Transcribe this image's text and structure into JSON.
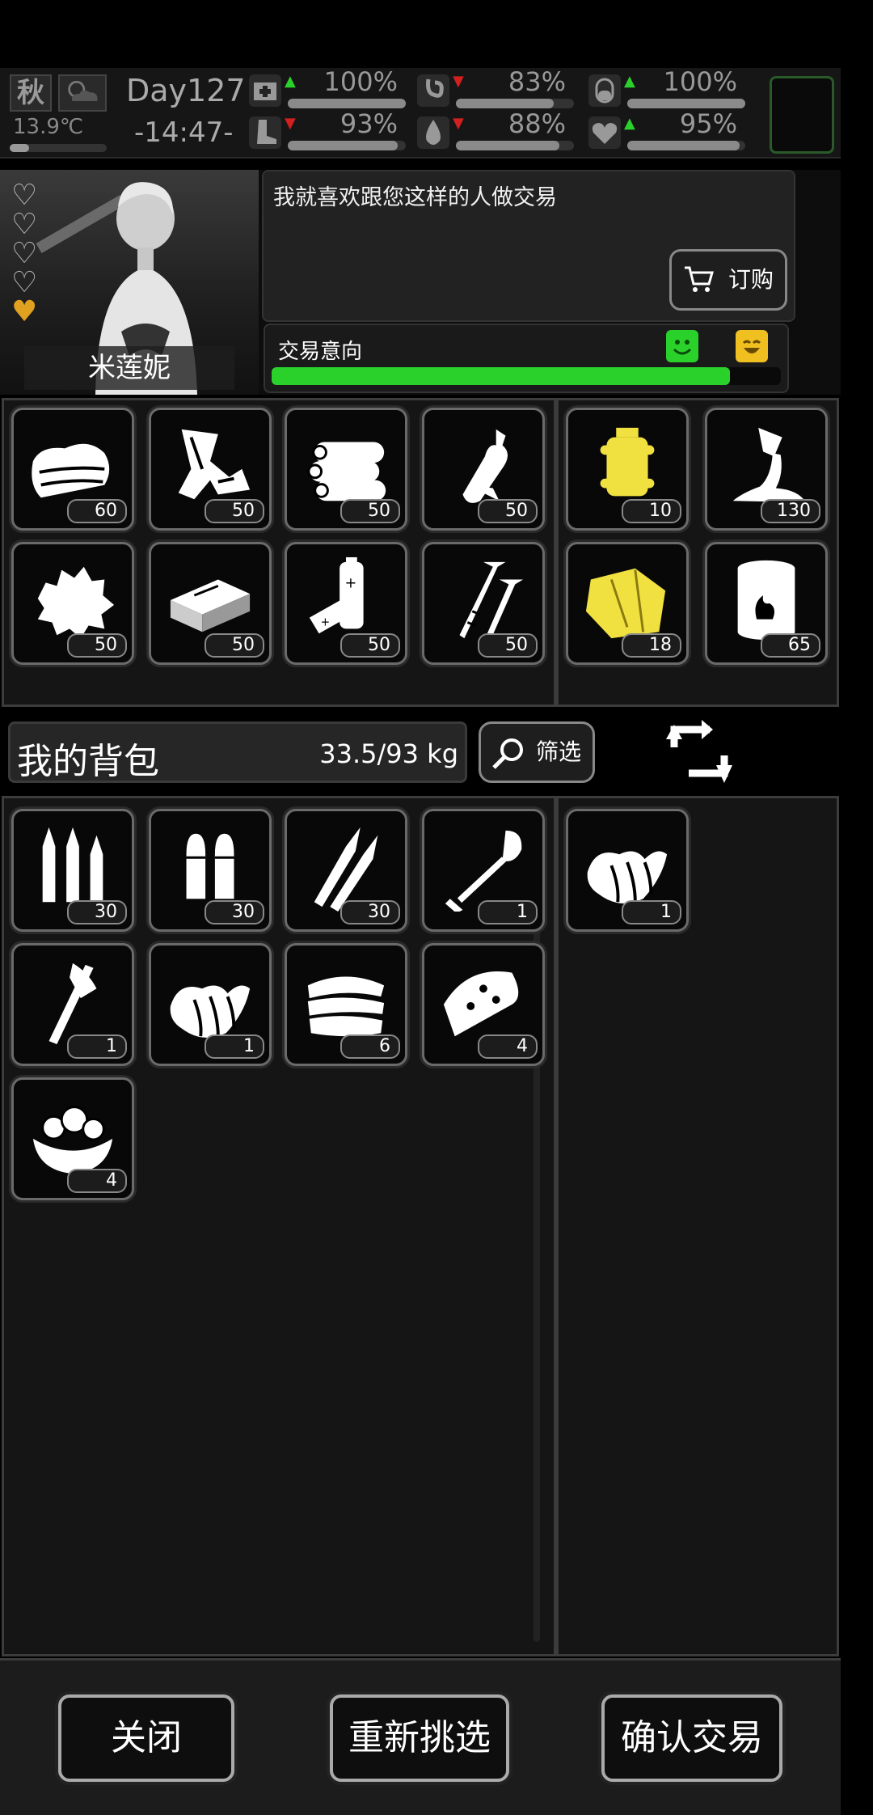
{
  "status": {
    "season": "秋",
    "temperature": "13.9℃",
    "day": "Day127",
    "time": "-14:47-",
    "stats": [
      {
        "name": "health",
        "icon": "medkit-icon",
        "value": "100%",
        "level": 1.0,
        "trend": "up"
      },
      {
        "name": "hunger",
        "icon": "stomach-icon",
        "value": "83%",
        "level": 0.83,
        "trend": "down"
      },
      {
        "name": "medicine",
        "icon": "pill-icon",
        "value": "100%",
        "level": 1.0,
        "trend": "up"
      },
      {
        "name": "stamina",
        "icon": "boot-icon",
        "value": "93%",
        "level": 0.93,
        "trend": "down"
      },
      {
        "name": "thirst",
        "icon": "water-drop-icon",
        "value": "88%",
        "level": 0.88,
        "trend": "down"
      },
      {
        "name": "mood",
        "icon": "heart-icon",
        "value": "95%",
        "level": 0.95,
        "trend": "up"
      }
    ]
  },
  "trader": {
    "name": "米莲妮",
    "message": "我就喜欢跟您这样的人做交易",
    "order_label": "订购",
    "intent_label": "交易意向",
    "intent_level": 0.9,
    "hearts": 5,
    "gold_hearts": 1
  },
  "trader_items": [
    {
      "icon": "cloth-icon",
      "count": "60"
    },
    {
      "icon": "scrap-metal-icon",
      "count": "50"
    },
    {
      "icon": "wood-logs-icon",
      "count": "50"
    },
    {
      "icon": "plastic-bottle-icon",
      "count": "50"
    },
    {
      "icon": "cotton-icon",
      "count": "50"
    },
    {
      "icon": "brick-icon",
      "count": "50"
    },
    {
      "icon": "battery-icon",
      "count": "50"
    },
    {
      "icon": "nails-icon",
      "count": "50"
    }
  ],
  "trader_offer": [
    {
      "icon": "gunpowder-icon",
      "count": "10",
      "highlight": true
    },
    {
      "icon": "glue-icon",
      "count": "130",
      "highlight": false
    },
    {
      "icon": "tarp-icon",
      "count": "18",
      "highlight": true
    },
    {
      "icon": "fuel-barrel-icon",
      "count": "65",
      "highlight": false
    }
  ],
  "bag": {
    "title": "我的背包",
    "weight": "33.5/93 kg",
    "filter_label": "筛选"
  },
  "bag_items": [
    {
      "icon": "rifle-ammo-icon",
      "count": "30"
    },
    {
      "icon": "pistol-ammo-icon",
      "count": "30"
    },
    {
      "icon": "bullets-icon",
      "count": "30"
    },
    {
      "icon": "shovel-icon",
      "count": "1"
    },
    {
      "icon": "axe-icon",
      "count": "1"
    },
    {
      "icon": "croissant-icon",
      "count": "1"
    },
    {
      "icon": "sandwich-icon",
      "count": "6"
    },
    {
      "icon": "pizza-slice-icon",
      "count": "4"
    },
    {
      "icon": "fruit-bowl-icon",
      "count": "4"
    }
  ],
  "my_offer": [
    {
      "icon": "croissant-icon",
      "count": "1"
    }
  ],
  "buttons": {
    "close": "关闭",
    "reselect": "重新挑选",
    "confirm": "确认交易"
  }
}
